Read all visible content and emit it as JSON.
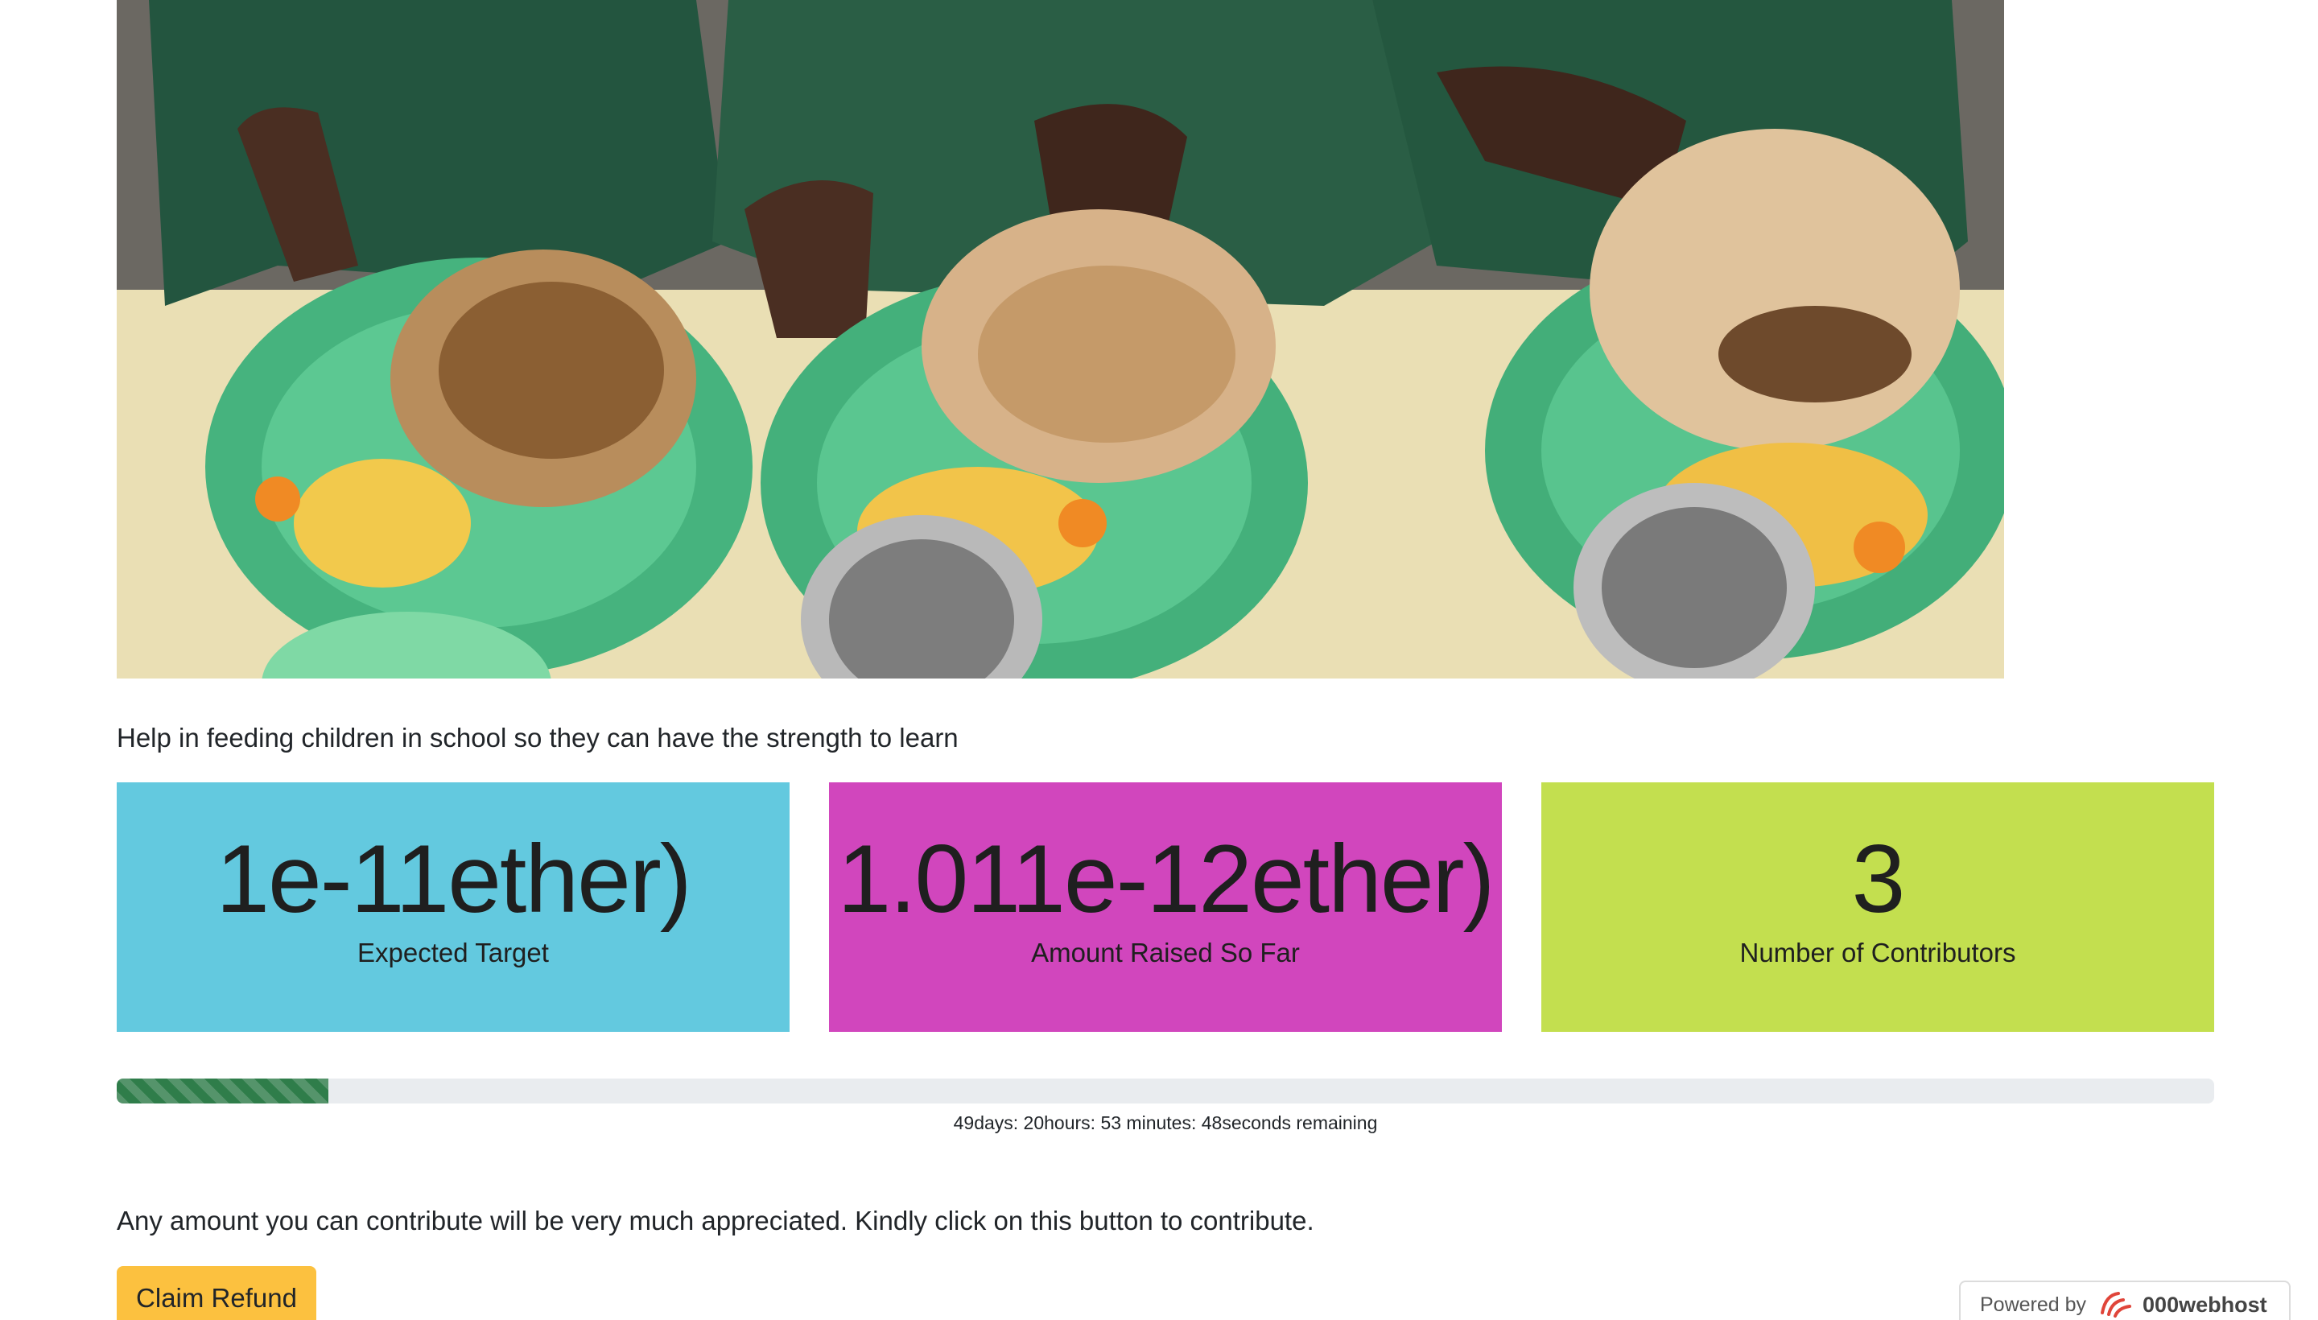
{
  "campaign": {
    "description": "Help in feeding children in school so they can have the strength to learn",
    "appeal": "Any amount you can contribute will be very much appreciated. Kindly click on this button to contribute."
  },
  "stats": {
    "target": {
      "value": "1e-11ether)",
      "label": "Expected Target",
      "color": "#63c9df"
    },
    "raised": {
      "value": "1.011e-12ether)",
      "label": "Amount Raised So Far",
      "color": "#d146bd"
    },
    "contributors": {
      "value": "3",
      "label": "Number of Contributors",
      "color": "#c3df4f"
    }
  },
  "progress": {
    "percent": 10.1,
    "countdown": "49days: 20hours: 53 minutes: 48seconds remaining"
  },
  "actions": {
    "claim_refund_label": "Claim Refund",
    "button_color": "#fcc13f"
  },
  "footer_badge": {
    "prefix": "Powered by",
    "brand": "000webhost",
    "brand_icon": "000webhost-logo-icon"
  }
}
